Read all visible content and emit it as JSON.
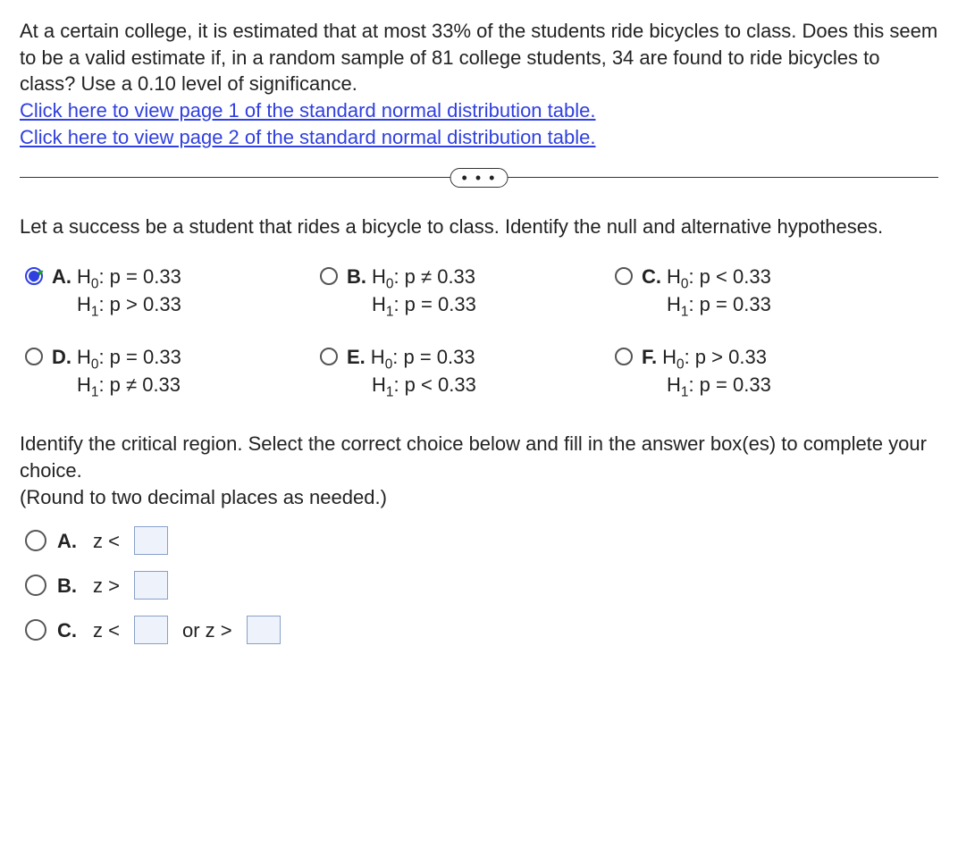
{
  "problem": {
    "text": "At a certain college, it is estimated that at most 33% of the students ride bicycles to class. Does this seem to be a valid estimate if, in a random sample of 81 college students, 34 are found to ride bicycles to class? Use a 0.10 level of significance.",
    "link1": "Click here to view page 1 of the standard normal distribution table.",
    "link2": "Click here to view page 2 of the standard normal distribution table."
  },
  "ellipsis": "• • •",
  "prompt1": "Let a success be a student that rides a bicycle to class. Identify the null and alternative hypotheses.",
  "choices": {
    "a": {
      "letter": "A.",
      "h0": "H",
      "h0sub": "0",
      "h0rest": ": p = 0.33",
      "h1": "H",
      "h1sub": "1",
      "h1rest": ": p > 0.33",
      "selected": true,
      "correct": true
    },
    "b": {
      "letter": "B.",
      "h0": "H",
      "h0sub": "0",
      "h0rest": ": p ≠ 0.33",
      "h1": "H",
      "h1sub": "1",
      "h1rest": ": p = 0.33"
    },
    "c": {
      "letter": "C.",
      "h0": "H",
      "h0sub": "0",
      "h0rest": ": p < 0.33",
      "h1": "H",
      "h1sub": "1",
      "h1rest": ": p = 0.33"
    },
    "d": {
      "letter": "D.",
      "h0": "H",
      "h0sub": "0",
      "h0rest": ": p = 0.33",
      "h1": "H",
      "h1sub": "1",
      "h1rest": ": p ≠ 0.33"
    },
    "e": {
      "letter": "E.",
      "h0": "H",
      "h0sub": "0",
      "h0rest": ": p = 0.33",
      "h1": "H",
      "h1sub": "1",
      "h1rest": ": p < 0.33"
    },
    "f": {
      "letter": "F.",
      "h0": "H",
      "h0sub": "0",
      "h0rest": ": p > 0.33",
      "h1": "H",
      "h1sub": "1",
      "h1rest": ": p = 0.33"
    }
  },
  "prompt2": "Identify the critical region. Select the correct choice below and fill in the answer box(es) to complete your choice.",
  "prompt2_note": "(Round to two decimal places as needed.)",
  "critical": {
    "a": {
      "letter": "A.",
      "pre": "z <"
    },
    "b": {
      "letter": "B.",
      "pre": "z >"
    },
    "c": {
      "letter": "C.",
      "pre": "z <",
      "mid": "or z >"
    }
  }
}
